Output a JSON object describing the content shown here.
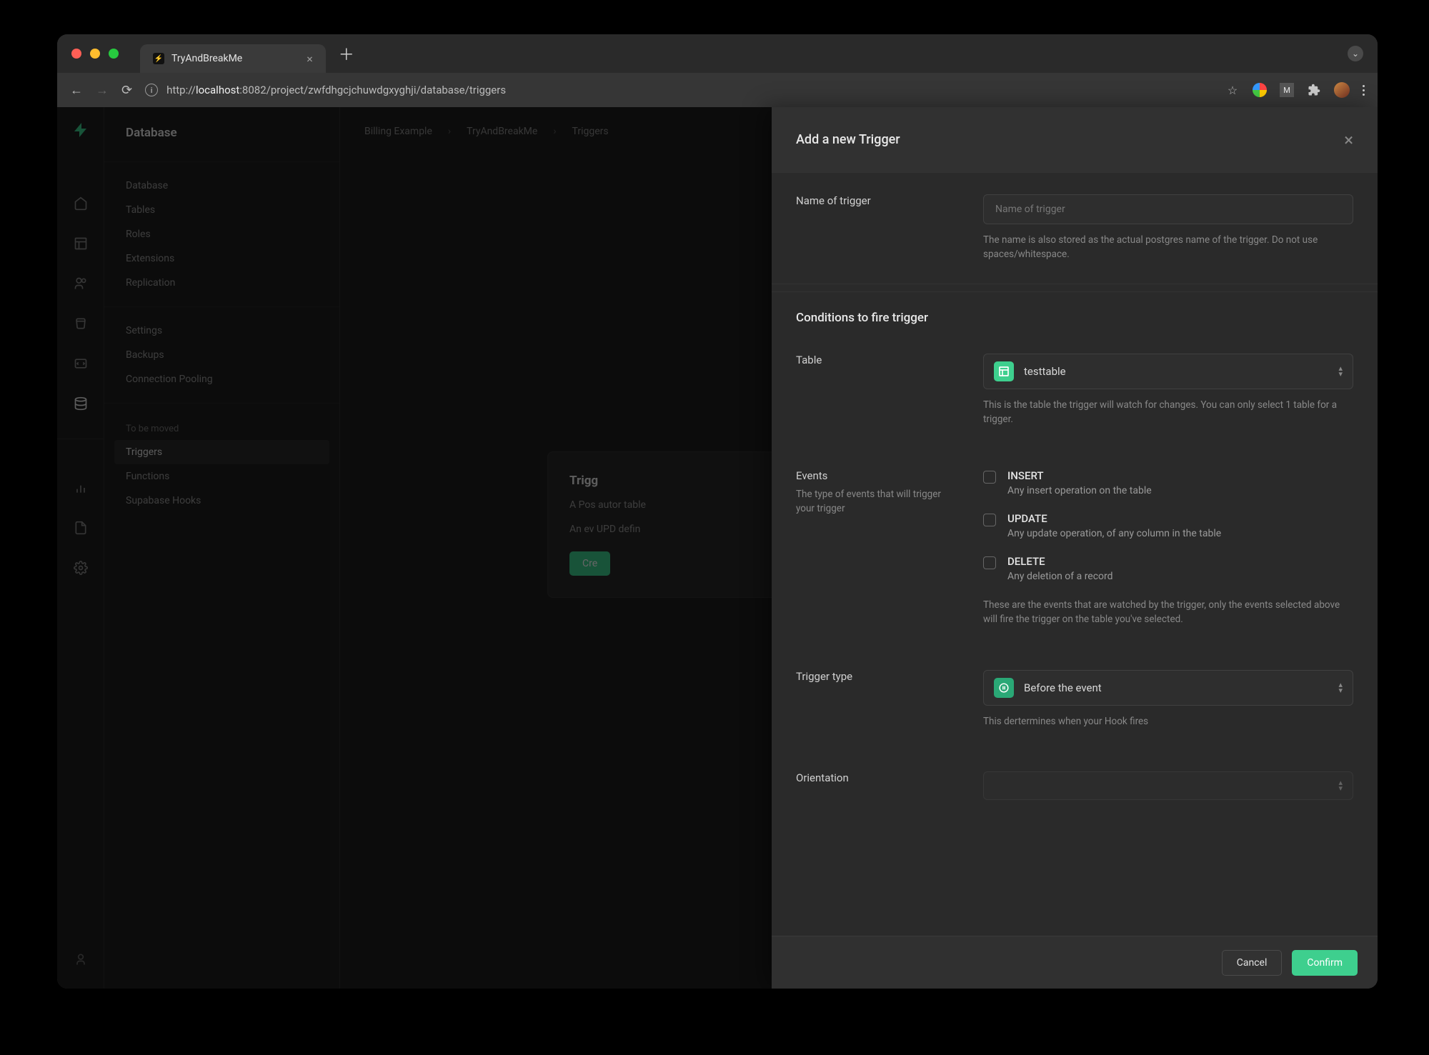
{
  "browser": {
    "tab_title": "TryAndBreakMe",
    "url_prefix": "http://",
    "url_host": "localhost",
    "url_rest": ":8082/project/zwfdhgcjchuwdgxyghji/database/triggers"
  },
  "sidebar": {
    "title": "Database",
    "group1": [
      "Database",
      "Tables",
      "Roles",
      "Extensions",
      "Replication"
    ],
    "group2": [
      "Settings",
      "Backups",
      "Connection Pooling"
    ],
    "group3_head": "To be moved",
    "group3": [
      "Triggers",
      "Functions",
      "Supabase Hooks"
    ]
  },
  "breadcrumb": [
    "Billing Example",
    "TryAndBreakMe",
    "Triggers"
  ],
  "card": {
    "title": "Trigg",
    "p1": "A Pos\nautor\ntable",
    "p2": "An ev\nUPD\ndefin",
    "btn": "Cre"
  },
  "panel": {
    "title": "Add a new Trigger",
    "name": {
      "label": "Name of trigger",
      "placeholder": "Name of trigger",
      "help": "The name is also stored as the actual postgres name of the trigger. Do not use spaces/whitespace."
    },
    "conditions_title": "Conditions to fire trigger",
    "table": {
      "label": "Table",
      "value": "testtable",
      "help": "This is the table the trigger will watch for changes. You can only select 1 table for a trigger."
    },
    "events": {
      "label": "Events",
      "sub": "The type of events that will trigger your trigger",
      "opts": [
        {
          "title": "INSERT",
          "desc": "Any insert operation on the table"
        },
        {
          "title": "UPDATE",
          "desc": "Any update operation, of any column in the table"
        },
        {
          "title": "DELETE",
          "desc": "Any deletion of a record"
        }
      ],
      "help": "These are the events that are watched by the trigger, only the events selected above will fire the trigger on the table you've selected."
    },
    "trigger_type": {
      "label": "Trigger type",
      "value": "Before the event",
      "help": "This dertermines when your Hook fires"
    },
    "orientation": {
      "label": "Orientation"
    },
    "footer": {
      "cancel": "Cancel",
      "confirm": "Confirm"
    }
  }
}
